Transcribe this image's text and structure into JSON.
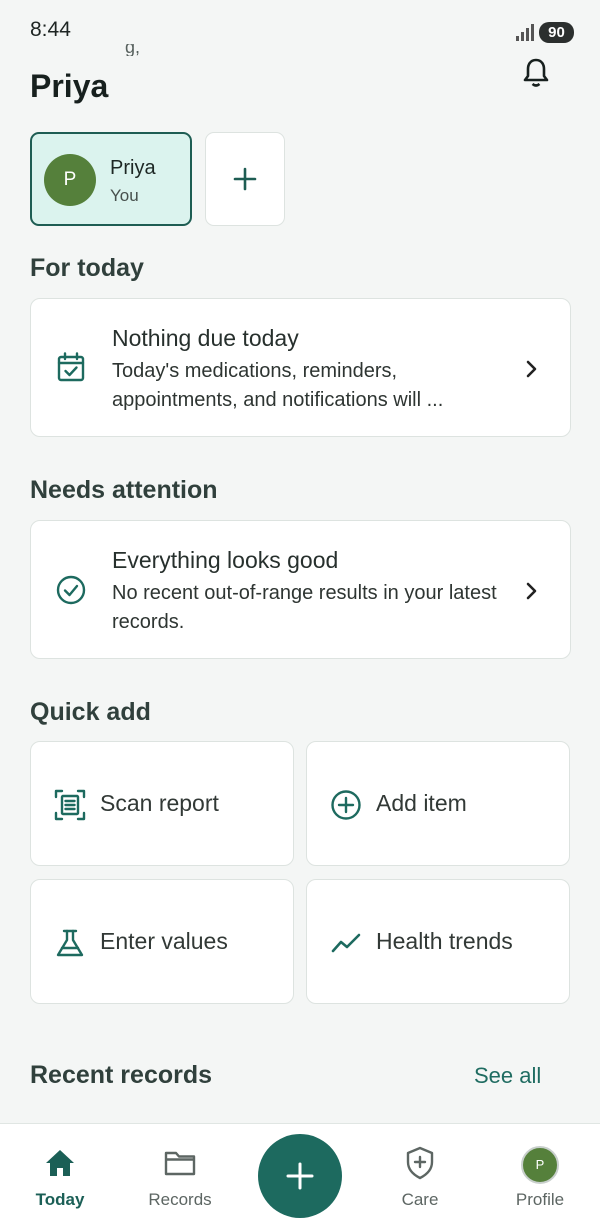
{
  "status_bar": {
    "time": "8:44",
    "battery": "90"
  },
  "header": {
    "greeting_fragment": "g,",
    "title": "Priya",
    "bell_icon": "bell-icon"
  },
  "profile_chip": {
    "avatar_letter": "P",
    "name": "Priya",
    "subtitle": "You"
  },
  "for_today": {
    "section_title": "For today",
    "card": {
      "icon": "calendar-check-icon",
      "title": "Nothing due today",
      "body": "Today's medications, reminders, appointments, and notifications will ..."
    }
  },
  "needs_attention": {
    "section_title": "Needs attention",
    "card": {
      "icon": "check-circle-icon",
      "title": "Everything looks good",
      "body": "No recent out-of-range results in your latest records."
    }
  },
  "quick_add": {
    "section_title": "Quick add",
    "items": [
      {
        "label": "Scan report",
        "icon": "scan-document-icon"
      },
      {
        "label": "Add item",
        "icon": "plus-circle-icon"
      },
      {
        "label": "Enter values",
        "icon": "flask-icon"
      },
      {
        "label": "Health trends",
        "icon": "trend-line-icon"
      }
    ]
  },
  "recent_records": {
    "section_title": "Recent records",
    "see_all": "See all"
  },
  "bottom_nav": {
    "items": [
      {
        "label": "Today",
        "icon": "home-icon",
        "active": true
      },
      {
        "label": "Records",
        "icon": "folder-icon"
      },
      {
        "label": "Care",
        "icon": "shield-plus-icon"
      },
      {
        "label": "Profile",
        "icon": "avatar",
        "avatar_letter": "P"
      }
    ],
    "fab_icon": "plus-icon"
  },
  "colors": {
    "accent": "#1d6a5f",
    "chip_bg": "#dbf3ee",
    "avatar": "#55803b",
    "background": "#f4f6f5"
  }
}
